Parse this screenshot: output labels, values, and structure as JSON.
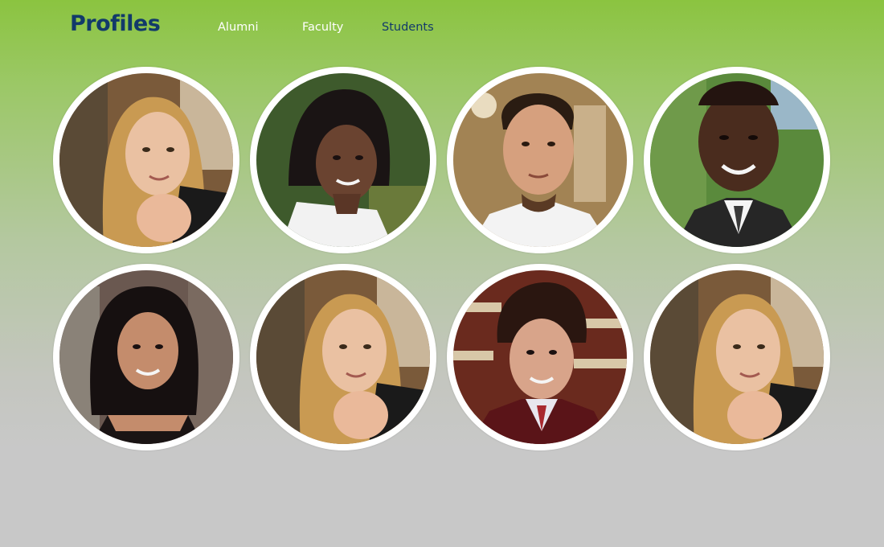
{
  "header": {
    "title": "Profiles",
    "nav": [
      {
        "label": "Alumni",
        "active": false
      },
      {
        "label": "Faculty",
        "active": false
      },
      {
        "label": "Students",
        "active": true
      }
    ]
  },
  "colors": {
    "title": "#123a6a",
    "nav_inactive": "#ffffff",
    "nav_active": "#123a6a",
    "bg_top": "#8bc440",
    "bg_bottom": "#c8c8c8",
    "ring": "#ffffff"
  },
  "profiles": [
    {
      "photo": "woman-long-blonde-hair-portrait"
    },
    {
      "photo": "woman-dark-hair-outdoors-portrait"
    },
    {
      "photo": "man-short-dark-hair-portrait"
    },
    {
      "photo": "man-suit-tie-outdoors-portrait"
    },
    {
      "photo": "woman-black-hair-building-portrait"
    },
    {
      "photo": "woman-long-blonde-hair-portrait"
    },
    {
      "photo": "man-tie-library-portrait"
    },
    {
      "photo": "woman-long-blonde-hair-portrait"
    }
  ]
}
